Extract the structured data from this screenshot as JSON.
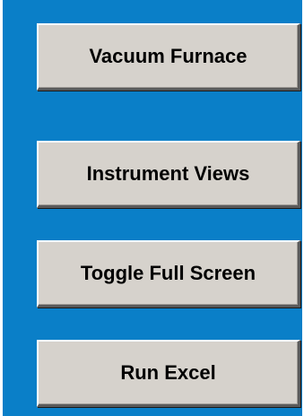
{
  "panel": {
    "background_color": "#0a7fc8",
    "buttons": [
      {
        "label": "Vacuum Furnace"
      },
      {
        "label": "Instrument Views"
      },
      {
        "label": "Toggle Full Screen"
      },
      {
        "label": "Run Excel"
      }
    ]
  }
}
